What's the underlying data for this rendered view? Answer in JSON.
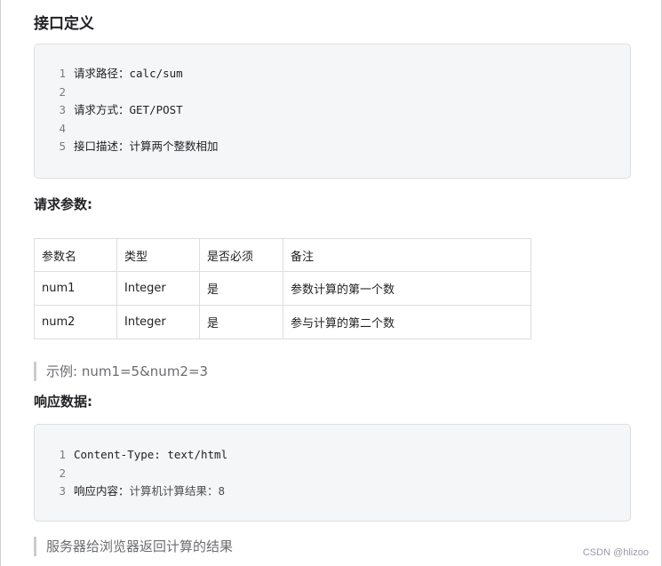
{
  "interface_section": {
    "title": "接口定义",
    "code_lines": [
      {
        "num": "1",
        "text": "请求路径：calc/sum"
      },
      {
        "num": "2",
        "text": ""
      },
      {
        "num": "3",
        "text": "请求方式：GET/POST"
      },
      {
        "num": "4",
        "text": ""
      },
      {
        "num": "5",
        "text": "接口描述：计算两个整数相加"
      }
    ]
  },
  "request_params": {
    "title": "请求参数:",
    "headers": [
      "参数名",
      "类型",
      "是否必须",
      "备注"
    ],
    "rows": [
      [
        "num1",
        "Integer",
        "是",
        "参数计算的第一个数"
      ],
      [
        "num2",
        "Integer",
        "是",
        "参与计算的第二个数"
      ]
    ],
    "example": "示例: num1=5&num2=3"
  },
  "response_section": {
    "title": "响应数据:",
    "code_lines": [
      {
        "num": "1",
        "key": "Content-Type: text/html",
        "val": ""
      },
      {
        "num": "2",
        "key": "",
        "val": ""
      },
      {
        "num": "3",
        "key": "响应内容：",
        "val": "计算机计算结果：8"
      }
    ],
    "note": "服务器给浏览器返回计算的结果"
  },
  "watermark": "CSDN @hlizoo"
}
